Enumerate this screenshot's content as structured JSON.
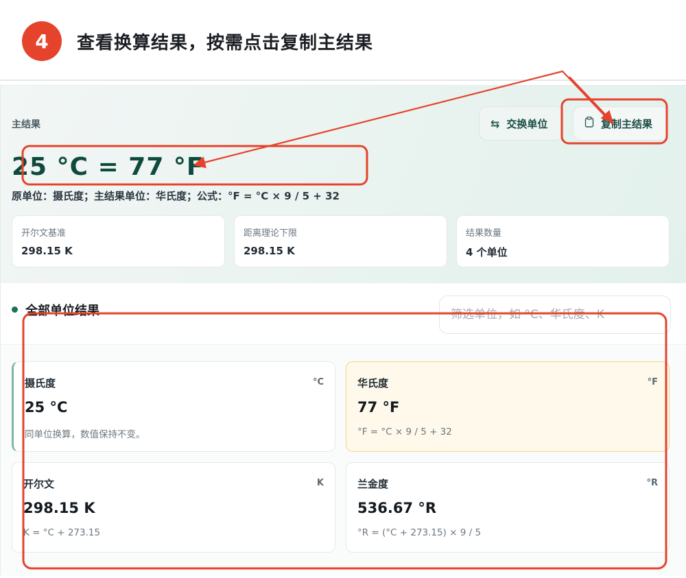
{
  "step": {
    "number": "4",
    "title": "查看换算结果，按需点击复制主结果"
  },
  "summary": {
    "label": "主结果",
    "swap_button": "交换单位",
    "copy_button": "复制主结果",
    "main_result": "25 °C = 77 °F",
    "formula_line": "原单位：摄氏度；主结果单位：华氏度；公式：°F = °C × 9 / 5 + 32",
    "stats": [
      {
        "label": "开尔文基准",
        "value": "298.15 K"
      },
      {
        "label": "距离理论下限",
        "value": "298.15 K"
      },
      {
        "label": "结果数量",
        "value": "4 个单位"
      }
    ]
  },
  "all_results": {
    "title": "全部单位结果",
    "filter_placeholder": "筛选单位，如 °C、华氏度、K",
    "cards": [
      {
        "name": "摄氏度",
        "symbol": "°C",
        "value": "25 °C",
        "note": "同单位换算，数值保持不变。"
      },
      {
        "name": "华氏度",
        "symbol": "°F",
        "value": "77 °F",
        "note": "°F = °C × 9 / 5 + 32"
      },
      {
        "name": "开尔文",
        "symbol": "K",
        "value": "298.15 K",
        "note": "K = °C + 273.15"
      },
      {
        "name": "兰金度",
        "symbol": "°R",
        "value": "536.67 °R",
        "note": "°R = (°C + 273.15) × 9 / 5"
      }
    ]
  },
  "colors": {
    "annotation": "#e5432b",
    "primary": "#0f4a3e",
    "highlight_card": "#fef9ea"
  },
  "icons": {
    "swap": "swap-arrows-icon",
    "copy": "clipboard-icon"
  }
}
